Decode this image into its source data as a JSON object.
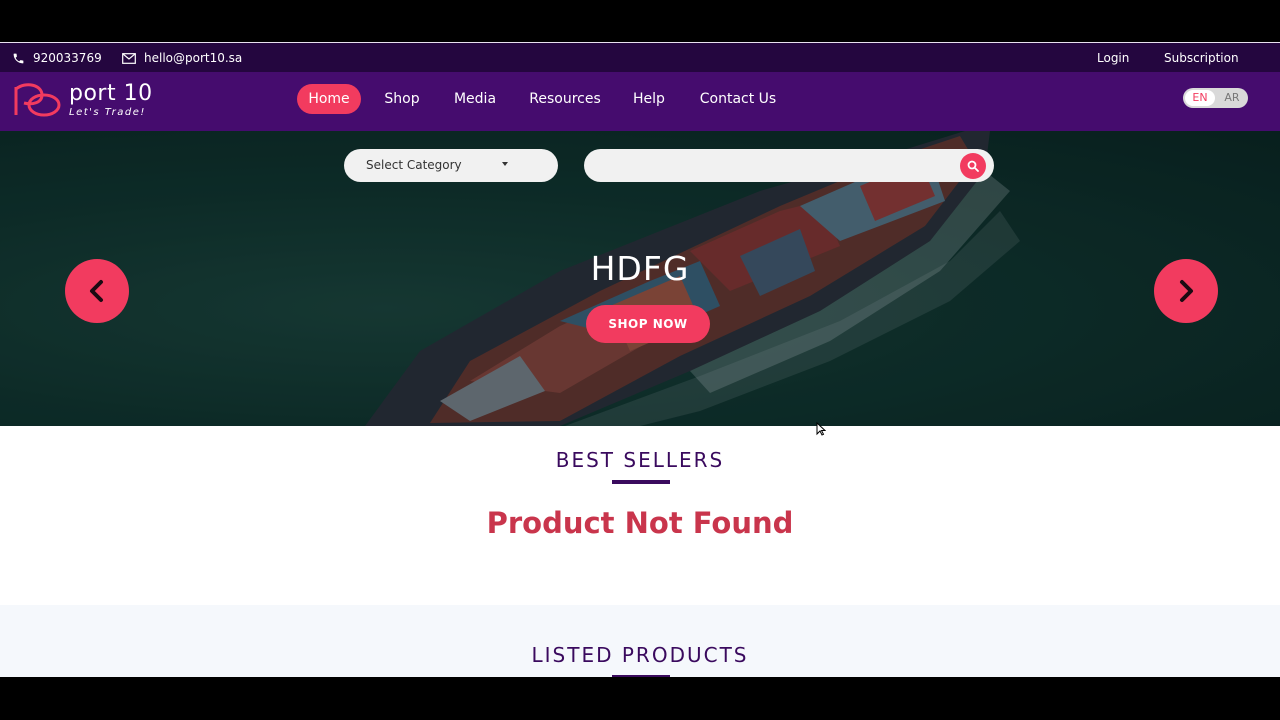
{
  "topbar": {
    "phone": "920033769",
    "email": "hello@port10.sa",
    "login": "Login",
    "subscription": "Subscription"
  },
  "brand": {
    "name": "port 10",
    "tagline": "Let's Trade!"
  },
  "nav": {
    "items": [
      {
        "label": "Home",
        "active": true
      },
      {
        "label": "Shop"
      },
      {
        "label": "Media"
      },
      {
        "label": "Resources"
      },
      {
        "label": "Help"
      },
      {
        "label": "Contact Us"
      }
    ]
  },
  "language": {
    "en": "EN",
    "ar": "AR",
    "selected": "EN"
  },
  "hero": {
    "category_select": "Select Category",
    "search_value": "",
    "title": "HDFG",
    "cta": "SHOP NOW"
  },
  "sections": {
    "best_sellers": "BEST SELLERS",
    "best_sellers_message": "Product Not Found",
    "listed_products": "LISTED PRODUCTS"
  },
  "icons": {
    "phone": "phone-icon",
    "email": "mail-icon",
    "search": "search-icon",
    "prev": "chevron-left-icon",
    "next": "chevron-right-icon",
    "dropdown": "caret-down-icon"
  },
  "colors": {
    "accent": "#f23b5f",
    "nav_bg": "#450c6e",
    "topbar_bg": "#24063f",
    "heading": "#3a0a5e",
    "error_text": "#c9354c"
  }
}
